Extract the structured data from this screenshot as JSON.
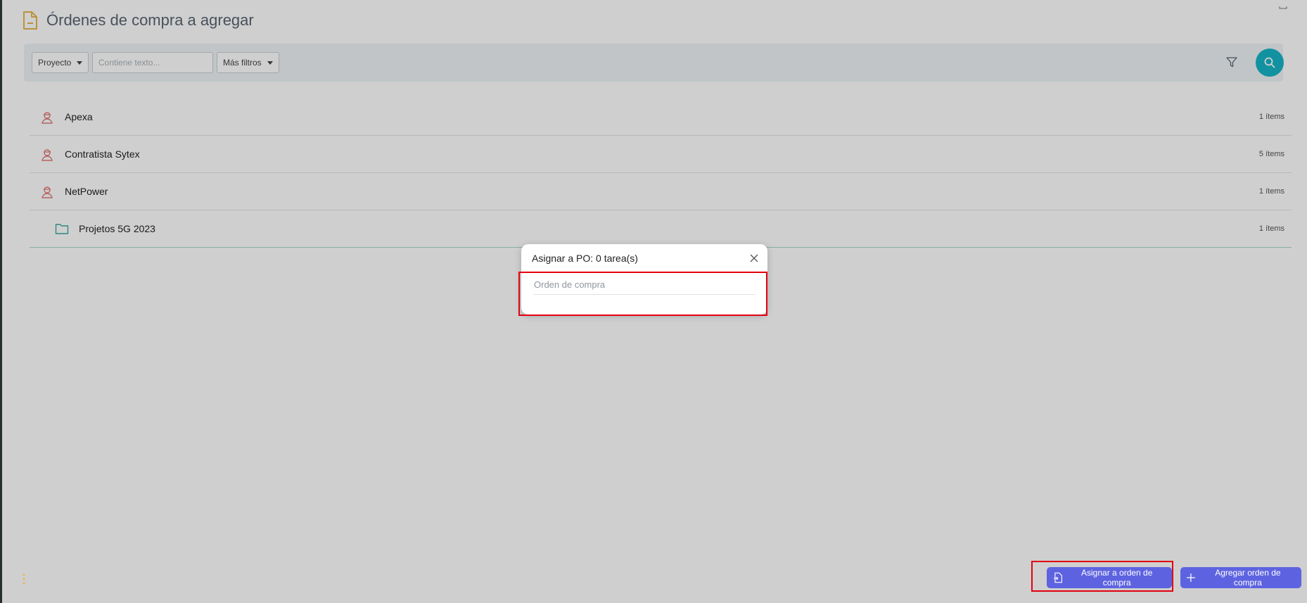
{
  "page": {
    "title": "Órdenes de compra a agregar",
    "title_icon": "document-icon"
  },
  "filters": {
    "project_label": "Proyecto",
    "text_placeholder": "Contiene texto...",
    "more_filters_label": "Más filtros",
    "funnel_icon": "funnel-icon",
    "search_icon": "search-icon"
  },
  "list": {
    "items": [
      {
        "label": "Apexa",
        "count": "1 ítems",
        "icon": "contractor-icon"
      },
      {
        "label": "Contratista Sytex",
        "count": "5 ítems",
        "icon": "contractor-icon"
      },
      {
        "label": "NetPower",
        "count": "1 ítems",
        "icon": "contractor-icon"
      },
      {
        "label": "Projetos 5G 2023",
        "count": "1 ítems",
        "icon": "folder-icon"
      }
    ]
  },
  "modal": {
    "title": "Asignar a PO: 0 tarea(s)",
    "input_placeholder": "Orden de compra",
    "close_icon": "close-icon"
  },
  "actions": {
    "assign_label": "Asignar a orden de compra",
    "add_label": "Agregar orden de compra"
  },
  "colors": {
    "accent": "#17b4c6",
    "button": "#5d63e0",
    "highlight": "#e3000f",
    "contractor_icon": "#e07a7a",
    "folder_icon": "#3aa99a",
    "document_icon": "#e7b64a"
  }
}
